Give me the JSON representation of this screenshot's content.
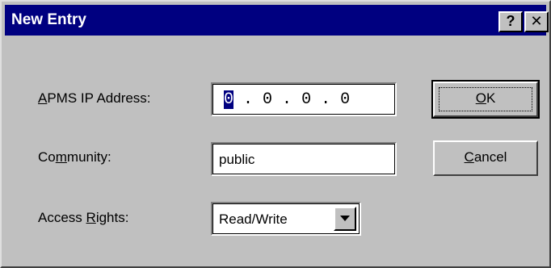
{
  "window": {
    "title": "New Entry",
    "help_glyph": "?",
    "close_glyph": "✕"
  },
  "fields": {
    "ip": {
      "label_underlined": "A",
      "label_rest": "PMS IP Address:",
      "octets": [
        "0",
        "0",
        "0",
        "0"
      ],
      "separator": " . "
    },
    "community": {
      "label_start": "Co",
      "label_underlined": "m",
      "label_end": "munity:",
      "value": "public"
    },
    "access": {
      "label_start": "Access ",
      "label_underlined": "R",
      "label_end": "ights:",
      "value": "Read/Write"
    }
  },
  "buttons": {
    "ok_underlined": "O",
    "ok_rest": "K",
    "cancel_underlined": "C",
    "cancel_rest": "ancel"
  },
  "colors": {
    "titlebar": "#000080",
    "face": "#c0c0c0",
    "selection": "#000080"
  },
  "icons": {
    "help": "question-mark",
    "close": "close-x",
    "dropdown": "chevron-down"
  }
}
